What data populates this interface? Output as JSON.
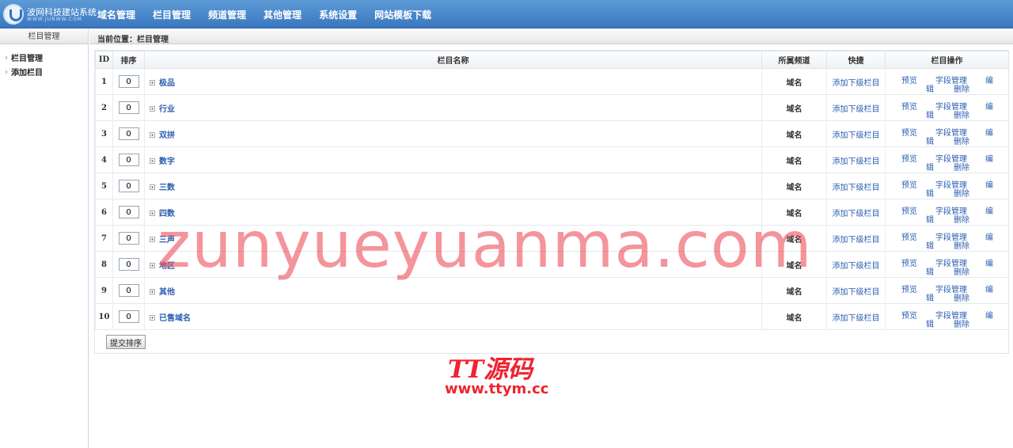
{
  "app": {
    "logo_title": "波网科技建站系统",
    "logo_subtitle": "WWW.JUNWW.COM"
  },
  "nav": {
    "items": [
      {
        "label": "域名管理"
      },
      {
        "label": "栏目管理"
      },
      {
        "label": "频道管理"
      },
      {
        "label": "其他管理"
      },
      {
        "label": "系统设置"
      },
      {
        "label": "网站模板下载"
      }
    ]
  },
  "sidebar": {
    "title": "栏目管理",
    "items": [
      {
        "label": "栏目管理"
      },
      {
        "label": "添加栏目"
      }
    ]
  },
  "breadcrumb": "当前位置：栏目管理",
  "table": {
    "headers": {
      "id": "ID",
      "sort": "排序",
      "name": "栏目名称",
      "channel": "所属频道",
      "quick": "快捷",
      "ops": "栏目操作"
    },
    "rows": [
      {
        "id": "1",
        "sort": "0",
        "name": "极品",
        "channel": "域名",
        "quick": "添加下级栏目"
      },
      {
        "id": "2",
        "sort": "0",
        "name": "行业",
        "channel": "域名",
        "quick": "添加下级栏目"
      },
      {
        "id": "3",
        "sort": "0",
        "name": "双拼",
        "channel": "域名",
        "quick": "添加下级栏目"
      },
      {
        "id": "4",
        "sort": "0",
        "name": "数字",
        "channel": "域名",
        "quick": "添加下级栏目"
      },
      {
        "id": "5",
        "sort": "0",
        "name": "三数",
        "channel": "域名",
        "quick": "添加下级栏目"
      },
      {
        "id": "6",
        "sort": "0",
        "name": "四数",
        "channel": "域名",
        "quick": "添加下级栏目"
      },
      {
        "id": "7",
        "sort": "0",
        "name": "三声",
        "channel": "域名",
        "quick": "添加下级栏目"
      },
      {
        "id": "8",
        "sort": "0",
        "name": "地区",
        "channel": "域名",
        "quick": "添加下级栏目"
      },
      {
        "id": "9",
        "sort": "0",
        "name": "其他",
        "channel": "域名",
        "quick": "添加下级栏目"
      },
      {
        "id": "10",
        "sort": "0",
        "name": "已售域名",
        "channel": "域名",
        "quick": "添加下级栏目"
      }
    ],
    "ops": {
      "preview": "预览",
      "edit_part1": "编",
      "edit_part2": "辑",
      "field_manage": "字段管理",
      "delete": "删除"
    }
  },
  "submit_button": "提交排序",
  "watermarks": {
    "big": "zunyueyuanma.com",
    "logo_text": "TT源码",
    "logo_url": "www.ttym.cc"
  },
  "colors": {
    "header_blue": "#3a78c0",
    "link_blue": "#2a5db0",
    "watermark_red": "#ec4652"
  }
}
